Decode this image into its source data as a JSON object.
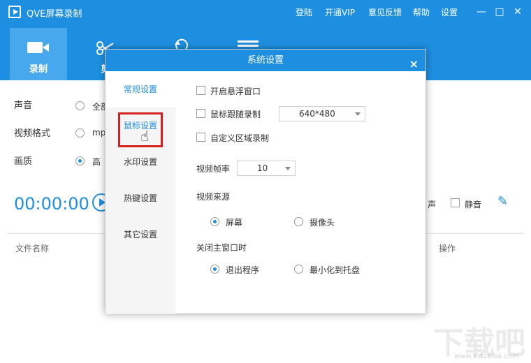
{
  "app": {
    "title": "QVE屏幕录制"
  },
  "top_menu": [
    "登陆",
    "开通VIP",
    "意见反馈",
    "帮助",
    "设置"
  ],
  "window_buttons": {
    "minimize": "—",
    "maximize": "□",
    "close": "✕"
  },
  "mode_tabs": [
    {
      "label": "录制",
      "icon": "video-camera-icon",
      "active": true
    },
    {
      "label": "剪",
      "icon": "scissors-icon"
    },
    {
      "label": "",
      "icon": "rotate-icon"
    },
    {
      "label": "",
      "icon": "menu-icon"
    }
  ],
  "main": {
    "rows": [
      {
        "label": "声音",
        "option": "全部"
      },
      {
        "label": "视频格式",
        "option": "mp"
      },
      {
        "label": "画质",
        "option": "高"
      }
    ],
    "timer": "00:00:00",
    "right_controls": {
      "partial_label": "声",
      "mute_label": "静音"
    },
    "columns": {
      "file_name": "文件名称",
      "actions": "操作"
    }
  },
  "dialog": {
    "title": "系统设置",
    "close": "×",
    "nav": [
      "常规设置",
      "鼠标设置",
      "水印设置",
      "热键设置",
      "其它设置"
    ],
    "nav_active_index": 0,
    "options": {
      "floating_window": "开启悬浮窗口",
      "follow_mouse": "鼠标跟随录制",
      "follow_mouse_size": "640*480",
      "custom_area": "自定义区域录制",
      "frame_rate_label": "视频帧率",
      "frame_rate_value": "10",
      "source_label": "视频来源",
      "source_screen": "屏幕",
      "source_camera": "摄像头",
      "close_label": "关闭主窗口时",
      "close_exit": "退出程序",
      "close_tray": "最小化到托盘"
    }
  },
  "watermark": {
    "text": "下载吧",
    "url": "www.xiazaiba.com"
  },
  "colors": {
    "primary": "#1e8fe0",
    "tab_active": "#48a8ee",
    "highlight": "#d32020"
  }
}
